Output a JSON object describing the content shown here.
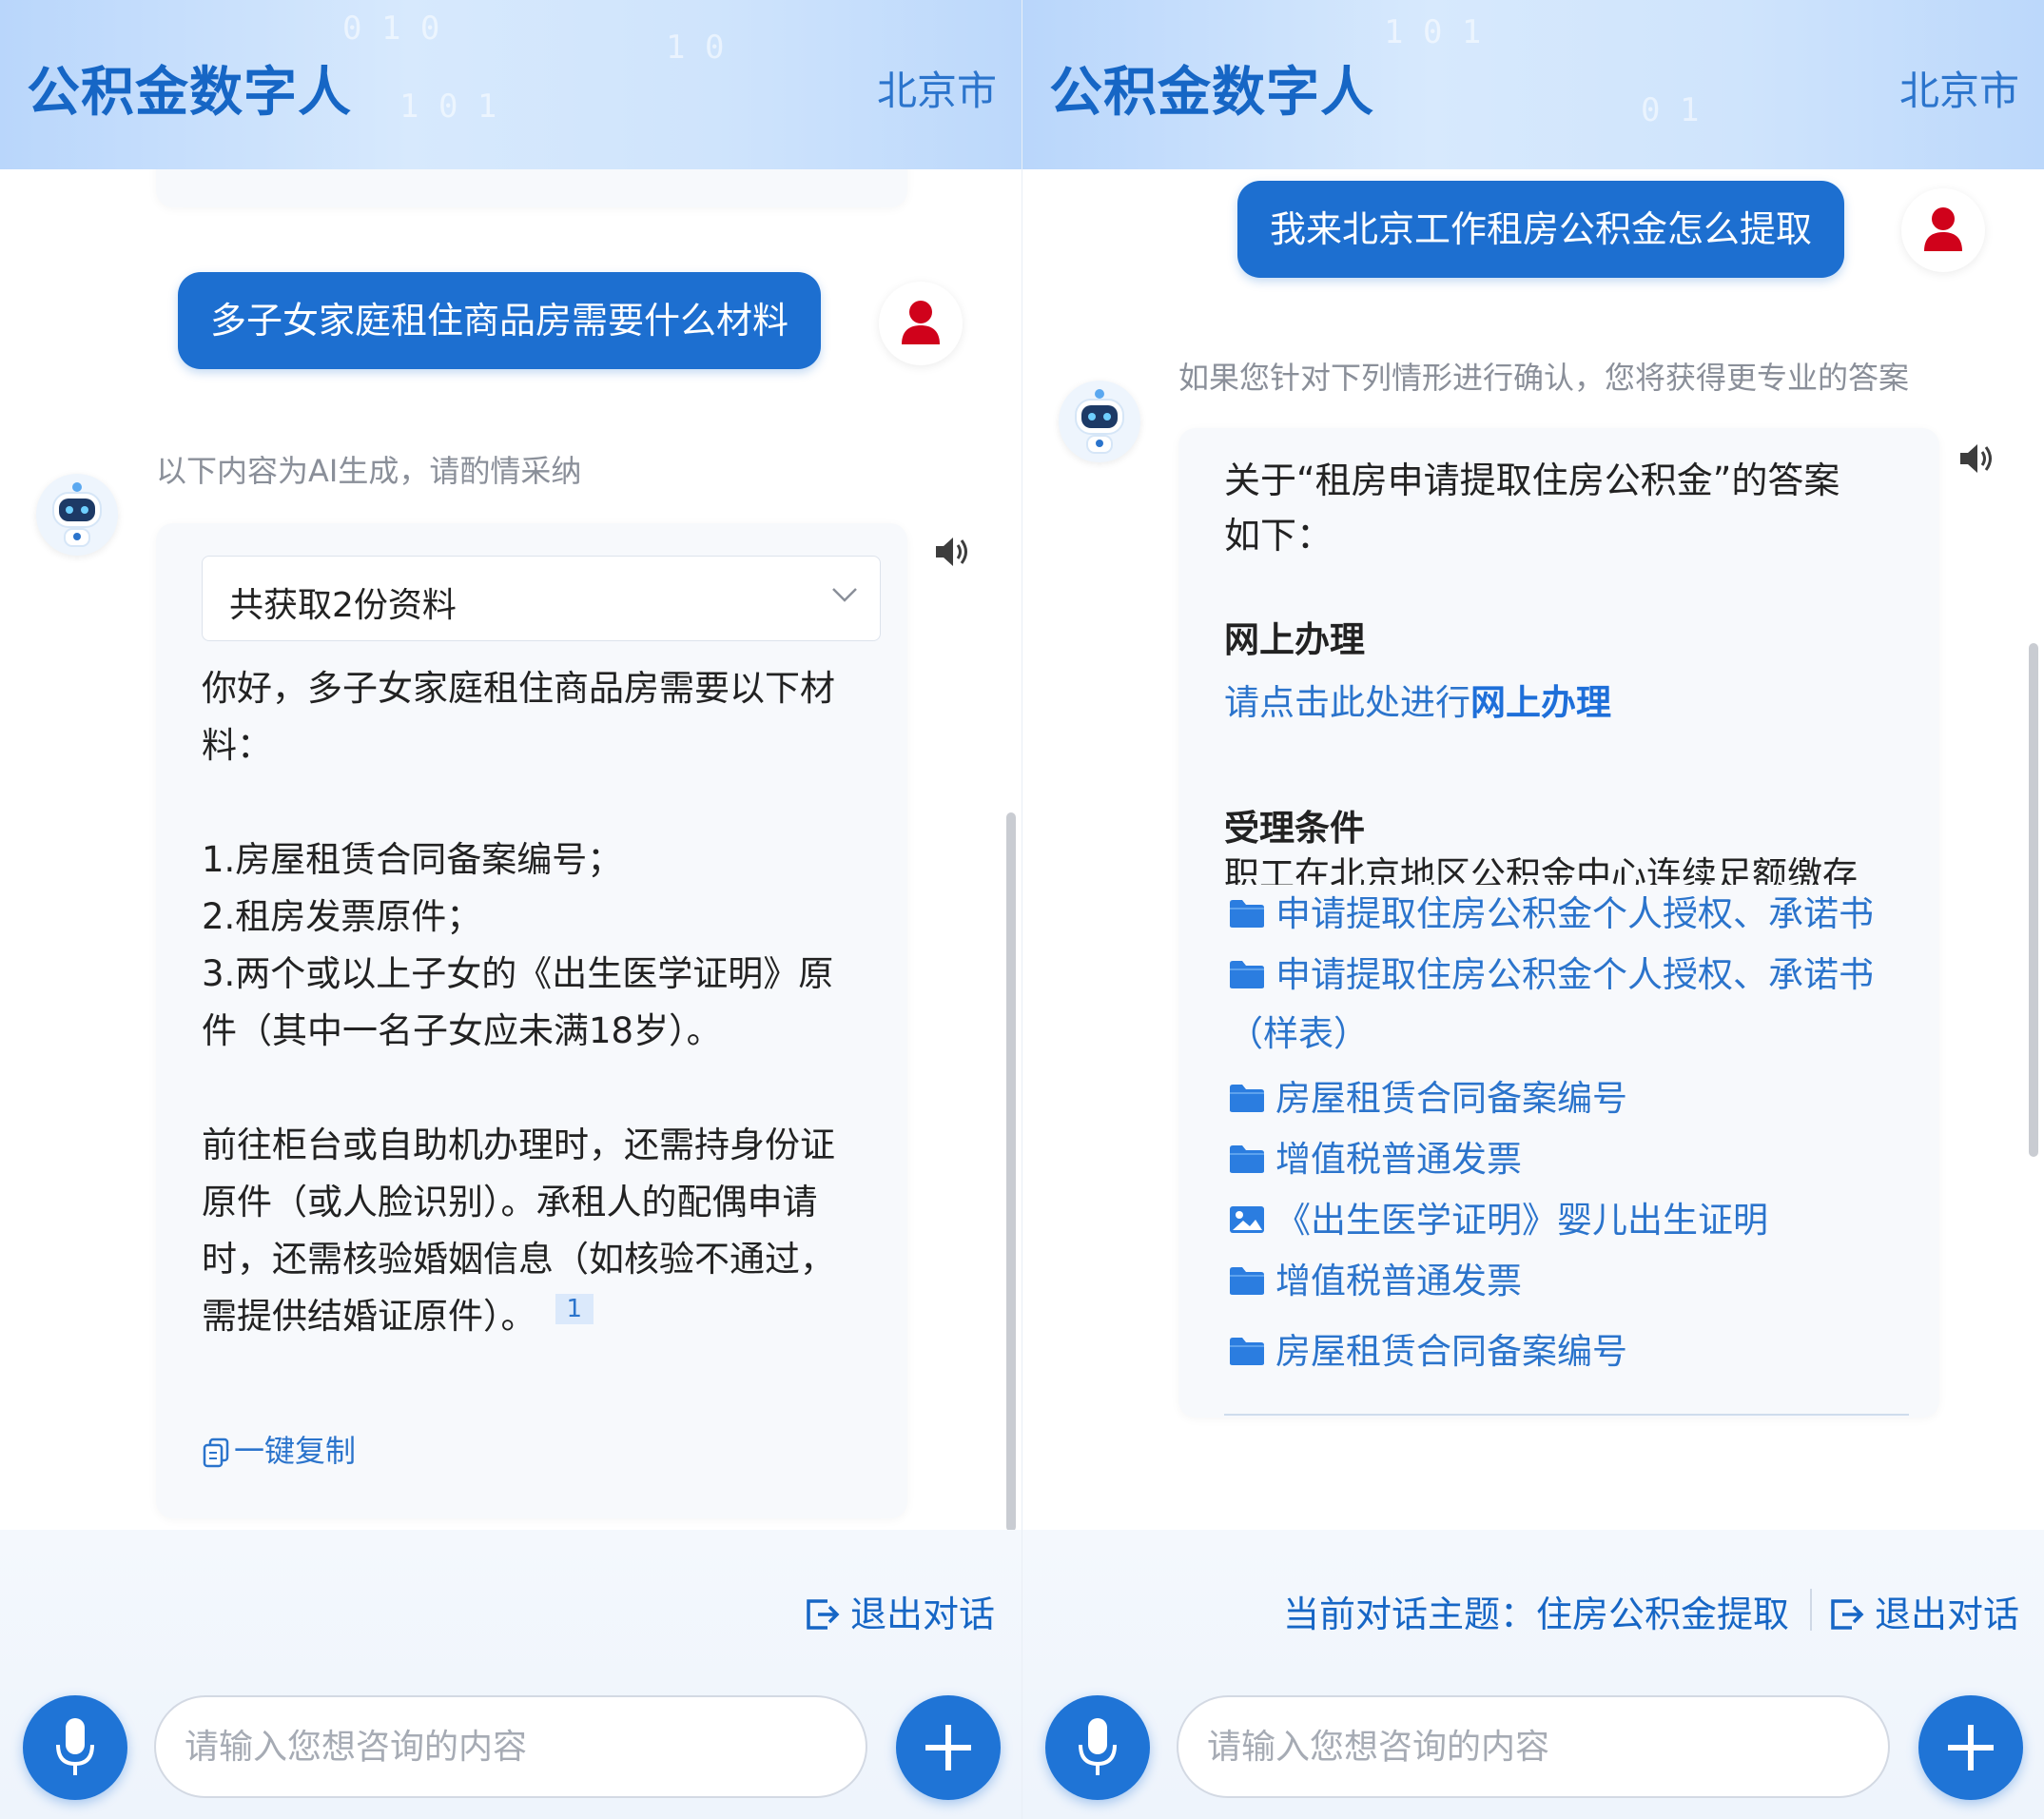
{
  "left": {
    "header": {
      "title": "公积金数字人",
      "city": "北京市"
    },
    "user_message": "多子女家庭租住商品房需要什么材料",
    "ai_notice": "以下内容为AI生成，请酌情采纳",
    "sources_dropdown": "共获取2份资料",
    "answer": {
      "intro_line1": "你好，多子女家庭租住商品房需要以下材",
      "intro_line2": "料：",
      "item1": "1.房屋租赁合同备案编号；",
      "item2": "2.租房发票原件；",
      "item3_line1": "3.两个或以上子女的《出生医学证明》原",
      "item3_line2": "件（其中一名子女应未满18岁）。",
      "note_line1": "前往柜台或自助机办理时，还需持身份证",
      "note_line2": "原件（或人脸识别）。承租人的配偶申请",
      "note_line3": "时，还需核验婚姻信息（如核验不通过，",
      "note_line4": "需提供结婚证原件）。",
      "ref": "1"
    },
    "copy_label": "一键复制",
    "exit_label": "退出对话",
    "input_placeholder": "请输入您想咨询的内容"
  },
  "right": {
    "header": {
      "title": "公积金数字人",
      "city": "北京市"
    },
    "user_message": "我来北京工作租房公积金怎么提取",
    "confirm_hint": "如果您针对下列情形进行确认，您将获得更专业的答案",
    "answer_title_line1": "关于“租房申请提取住房公积金”的答案",
    "answer_title_line2": "如下：",
    "online_section": "网上办理",
    "online_link_prefix": "请点击此处进行",
    "online_link_bold": "网上办理",
    "conditions_section": "受理条件",
    "conditions_text": "职工在北京地区公积金中心连续足额缴存",
    "attachments": [
      {
        "label": "申请提取住房公积金个人授权、承诺书",
        "icon": "folder-icon"
      },
      {
        "label": "申请提取住房公积金个人授权、承诺书（样表）",
        "icon": "folder-icon"
      },
      {
        "label": "房屋租赁合同备案编号",
        "icon": "folder-icon"
      },
      {
        "label": "增值税普通发票",
        "icon": "folder-icon"
      },
      {
        "label": "《出生医学证明》婴儿出生证明",
        "icon": "image-icon"
      },
      {
        "label": "增值税普通发票",
        "icon": "folder-icon"
      },
      {
        "label": "房屋租赁合同备案编号",
        "icon": "folder-icon"
      }
    ],
    "topic_label": "当前对话主题：住房公积金提取",
    "exit_label": "退出对话",
    "input_placeholder": "请输入您想咨询的内容"
  },
  "colors": {
    "brand": "#1d6fd0",
    "link": "#2b74cc",
    "user_avatar": "#d0021b"
  }
}
